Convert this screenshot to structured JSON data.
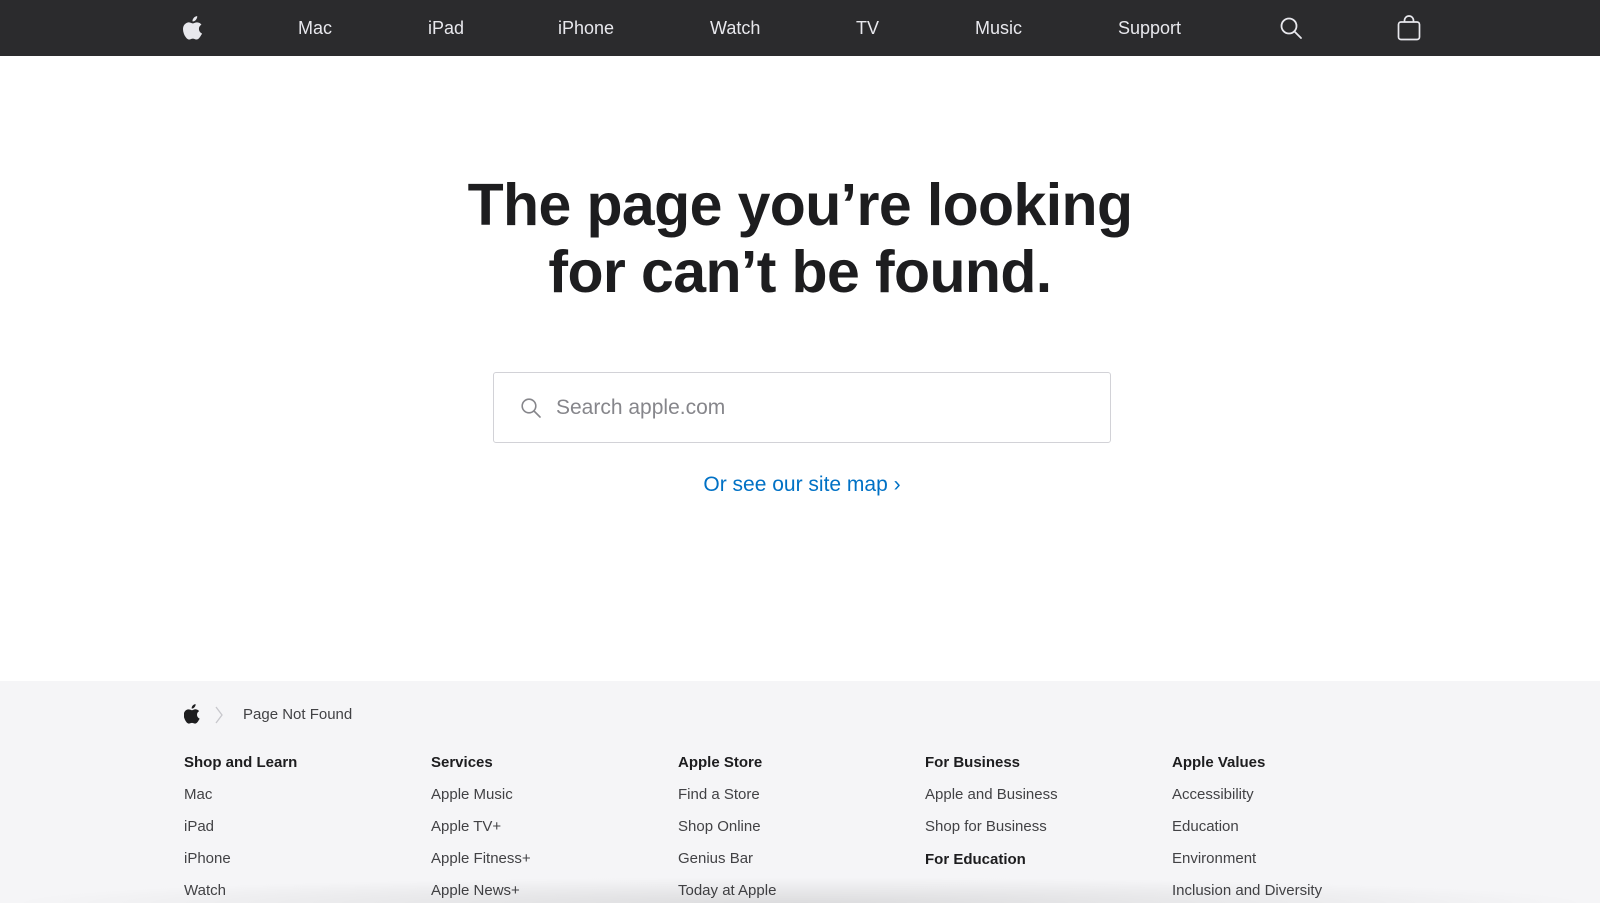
{
  "nav": {
    "items": [
      {
        "label": "Mac"
      },
      {
        "label": "iPad"
      },
      {
        "label": "iPhone"
      },
      {
        "label": "Watch"
      },
      {
        "label": "TV"
      },
      {
        "label": "Music"
      },
      {
        "label": "Support"
      }
    ],
    "logo_icon": "apple-logo-icon",
    "search_icon": "search-icon",
    "bag_icon": "shopping-bag-icon"
  },
  "main": {
    "headline_line1": "The page you’re looking",
    "headline_line2": "for can’t be found.",
    "search_placeholder": "Search apple.com",
    "sitemap_link": "Or see our site map ›",
    "link_color": "#0071c5"
  },
  "footer": {
    "breadcrumb": {
      "label": "Page Not Found"
    },
    "columns": [
      {
        "heading": "Shop and Learn",
        "items": [
          "Mac",
          "iPad",
          "iPhone",
          "Watch"
        ]
      },
      {
        "heading": "Services",
        "items": [
          "Apple Music",
          "Apple TV+",
          "Apple Fitness+",
          "Apple News+"
        ]
      },
      {
        "heading": "Apple Store",
        "items": [
          "Find a Store",
          "Shop Online",
          "Genius Bar",
          "Today at Apple"
        ]
      },
      {
        "heading": "For Business",
        "items": [
          "Apple and Business",
          "Shop for Business"
        ],
        "subheading": "For Education"
      },
      {
        "heading": "Apple Values",
        "items": [
          "Accessibility",
          "Education",
          "Environment",
          "Inclusion and Diversity"
        ]
      }
    ]
  },
  "colors": {
    "nav_background": "#2b2b2d",
    "footer_background": "#f5f5f7",
    "headline": "#1d1d1f"
  }
}
